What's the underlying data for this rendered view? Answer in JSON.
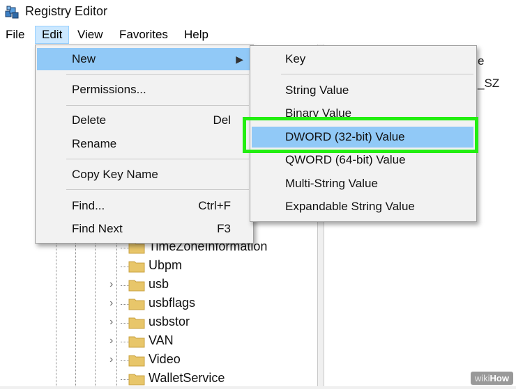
{
  "window": {
    "title": "Registry Editor",
    "icon": "registry-cubes-icon"
  },
  "menubar": {
    "items": [
      "File",
      "Edit",
      "View",
      "Favorites",
      "Help"
    ],
    "active": "Edit"
  },
  "edit_menu": {
    "items": [
      {
        "label": "New",
        "shortcut": "",
        "submenu": true
      },
      {
        "label": "Permissions...",
        "shortcut": ""
      },
      {
        "label": "Delete",
        "shortcut": "Del"
      },
      {
        "label": "Rename",
        "shortcut": ""
      },
      {
        "label": "Copy Key Name",
        "shortcut": ""
      },
      {
        "label": "Find...",
        "shortcut": "Ctrl+F"
      },
      {
        "label": "Find Next",
        "shortcut": "F3"
      }
    ],
    "highlighted": "New"
  },
  "new_submenu": {
    "items": [
      "Key",
      "String Value",
      "Binary Value",
      "DWORD (32-bit) Value",
      "QWORD (64-bit) Value",
      "Multi-String Value",
      "Expandable String Value"
    ],
    "highlighted": "DWORD (32-bit) Value"
  },
  "tree": {
    "items": [
      {
        "label": "TimeZoneInformation",
        "expandable": false
      },
      {
        "label": "Ubpm",
        "expandable": false
      },
      {
        "label": "usb",
        "expandable": true
      },
      {
        "label": "usbflags",
        "expandable": true
      },
      {
        "label": "usbstor",
        "expandable": true
      },
      {
        "label": "VAN",
        "expandable": true
      },
      {
        "label": "Video",
        "expandable": true
      },
      {
        "label": "WalletService",
        "expandable": false
      }
    ]
  },
  "value_pane": {
    "fragments": [
      "e",
      "_SZ"
    ]
  },
  "colors": {
    "highlight": "#91c9f7",
    "callout_box": "#22ee11",
    "folder": "#e8c66a"
  },
  "watermark": {
    "prefix": "wiki",
    "brand": "How"
  }
}
